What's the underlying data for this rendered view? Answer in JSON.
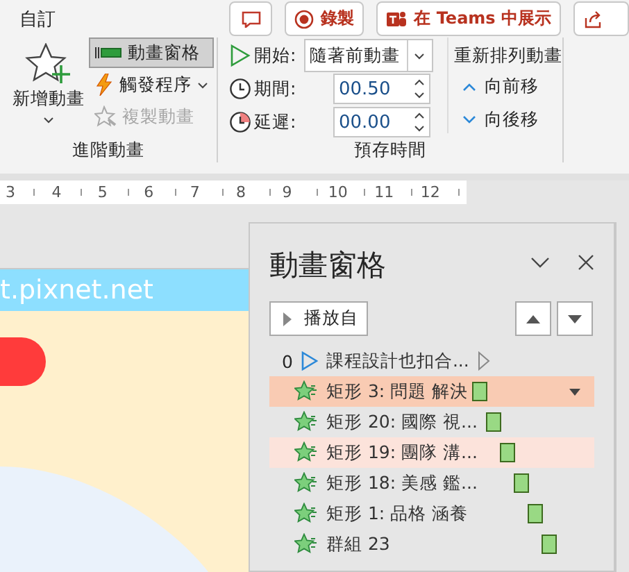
{
  "top_bar": {
    "label": "自訂",
    "buttons": [
      {
        "kind": "comment"
      },
      {
        "kind": "record",
        "label": "錄製"
      },
      {
        "kind": "teams",
        "label": "在 Teams 中展示"
      },
      {
        "kind": "share"
      }
    ]
  },
  "advanced_animation": {
    "add_button": "新增動畫",
    "pane_button": {
      "label": "動畫窗格",
      "selected": true
    },
    "trigger_button": "觸發程序",
    "painter_button": {
      "label": "複製動畫",
      "disabled": true
    },
    "group_label": "進階動畫"
  },
  "timing": {
    "start": {
      "label": "開始:",
      "value": "隨著前動畫"
    },
    "duration": {
      "label": "期間:",
      "value": "00.50"
    },
    "delay": {
      "label": "延遲:",
      "value": "00.00"
    },
    "reorder_title": "重新排列動畫",
    "move_earlier": "向前移",
    "move_later": "向後移",
    "group_label": "預存時間"
  },
  "ruler": {
    "ticks": [
      "3",
      "4",
      "5",
      "6",
      "7",
      "8",
      "9",
      "10",
      "11",
      "12"
    ]
  },
  "slide": {
    "banner_text": "t.pixnet.net"
  },
  "animation_pane": {
    "title": "動畫窗格",
    "play_button": "播放自",
    "items": [
      {
        "kind": "trigger",
        "index": "0",
        "label": "課程設計也扣合...",
        "selected": false,
        "highlighted": false
      },
      {
        "kind": "effect",
        "label": "矩形 3: 問題 解決",
        "selected": true,
        "highlighted": false
      },
      {
        "kind": "effect",
        "label": "矩形 20: 國際 視...",
        "selected": false,
        "highlighted": false
      },
      {
        "kind": "effect",
        "label": "矩形 19: 團隊 溝...",
        "selected": false,
        "highlighted": true
      },
      {
        "kind": "effect",
        "label": "矩形 18: 美感 鑑...",
        "selected": false,
        "highlighted": false
      },
      {
        "kind": "effect",
        "label": "矩形 1: 品格 涵養",
        "selected": false,
        "highlighted": false
      },
      {
        "kind": "effect",
        "label": "群組 23",
        "selected": false,
        "highlighted": false
      }
    ]
  }
}
